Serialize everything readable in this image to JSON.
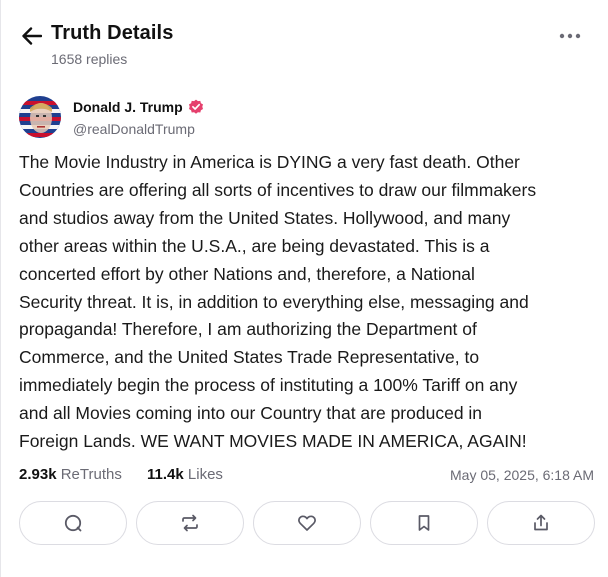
{
  "header": {
    "title": "Truth Details",
    "replies": "1658 replies"
  },
  "post": {
    "author": {
      "name": "Donald J. Trump",
      "handle": "@realDonaldTrump"
    },
    "body": "The Movie Industry in America is DYING a very fast death. Other\nCountries are offering all sorts of incentives to draw our filmmakers\nand studios away from the United States. Hollywood, and many\nother areas within the U.S.A., are being devastated. This is a\nconcerted effort by other Nations and, therefore, a National\nSecurity threat. It is, in addition to everything else, messaging and\npropaganda! Therefore, I am authorizing the Department of\nCommerce, and the United States Trade Representative, to\nimmediately begin the process of instituting a 100% Tariff on any\nand all Movies coming into our Country that are produced in\nForeign Lands. WE WANT MOVIES MADE IN AMERICA, AGAIN!",
    "stats": {
      "retruths_count": "2.93k",
      "retruths_label": "ReTruths",
      "likes_count": "11.4k",
      "likes_label": "Likes",
      "timestamp": "May 05, 2025, 6:18 AM"
    }
  },
  "icons": {
    "back": "arrow-left-icon",
    "more": "more-horizontal-icon",
    "verified": "verified-badge-icon",
    "reply": "comment-icon",
    "retruth": "repost-icon",
    "like": "heart-icon",
    "bookmark": "bookmark-icon",
    "share": "share-icon"
  },
  "colors": {
    "verified": "#e5406d",
    "muted_text": "#6b6b75",
    "border": "#dcdce2"
  }
}
